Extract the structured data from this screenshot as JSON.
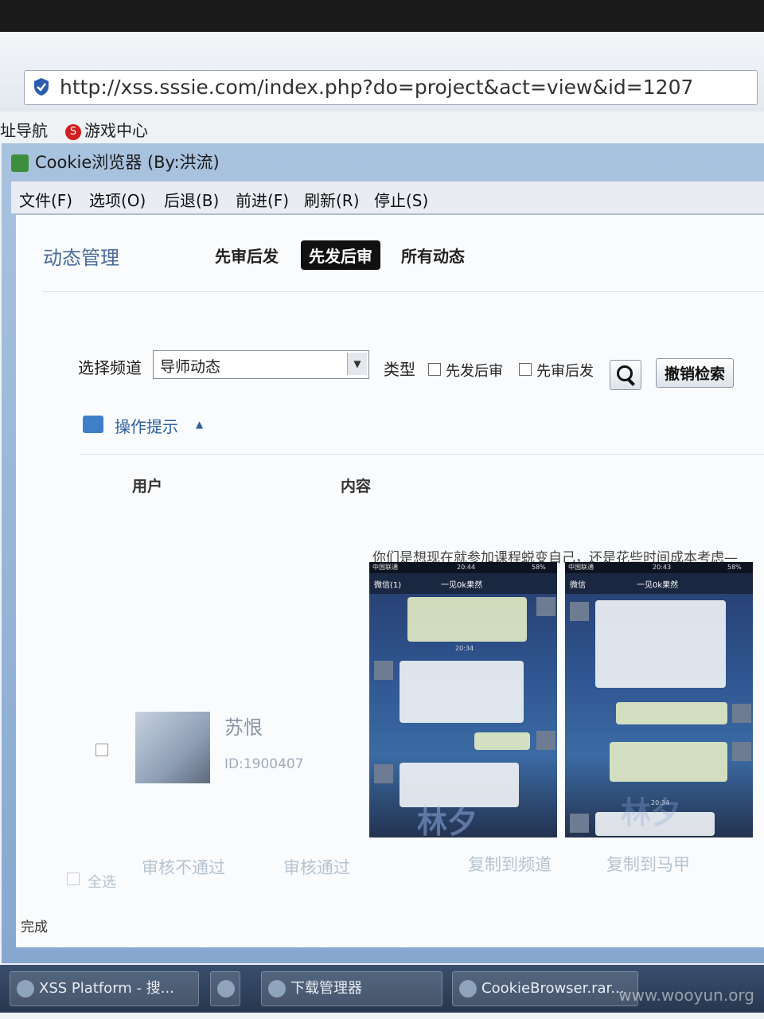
{
  "address_bar": {
    "url": "http://xss.sssie.com/index.php?do=project&act=view&id=1207"
  },
  "bookmarks": [
    {
      "label": "址导航"
    },
    {
      "label": "游戏中心",
      "icon": "S"
    }
  ],
  "window": {
    "title": "Cookie浏览器 (By:洪流)",
    "menu": [
      "文件(F)",
      "选项(O)",
      "后退(B)",
      "前进(F)",
      "刷新(R)",
      "停止(S)"
    ]
  },
  "page": {
    "title": "动态管理",
    "tabs": [
      "先审后发",
      "先发后审",
      "所有动态"
    ],
    "active_tab": "先发后审",
    "filter": {
      "channel_label": "选择频道",
      "channel_value": "导师动态",
      "type_label": "类型",
      "type_options": [
        "先发后审",
        "先审后发"
      ],
      "reset_button": "撤销检索"
    },
    "tip_label": "操作提示",
    "table": {
      "columns": [
        "用户",
        "内容"
      ],
      "rows": [
        {
          "user_name": "苏恨",
          "user_id": "ID:1900407",
          "content_text": "你们是想现在就参加课程蜕变自己，还是花些时间成本考虑—",
          "screenshots": [
            {
              "carrier": "中国联通",
              "time": "20:44",
              "battery": "58%",
              "back": "微信(1)",
              "chat_title": "一见0k果然",
              "stamp": "20:34",
              "bg_text": "林夕"
            },
            {
              "carrier": "中国联通",
              "time": "20:43",
              "battery": "58%",
              "back": "微信",
              "chat_title": "一见0k果然",
              "stamp": "20:34",
              "bg_text": "林夕"
            }
          ]
        }
      ]
    },
    "select_all": "全选",
    "actions": [
      "审核不通过",
      "审核通过",
      "复制到频道",
      "复制到马甲"
    ]
  },
  "status": "完成",
  "taskbar": [
    "XSS Platform - 搜...",
    "下载管理器",
    "CookieBrowser.rar..."
  ],
  "watermark": "www.wooyun.org"
}
